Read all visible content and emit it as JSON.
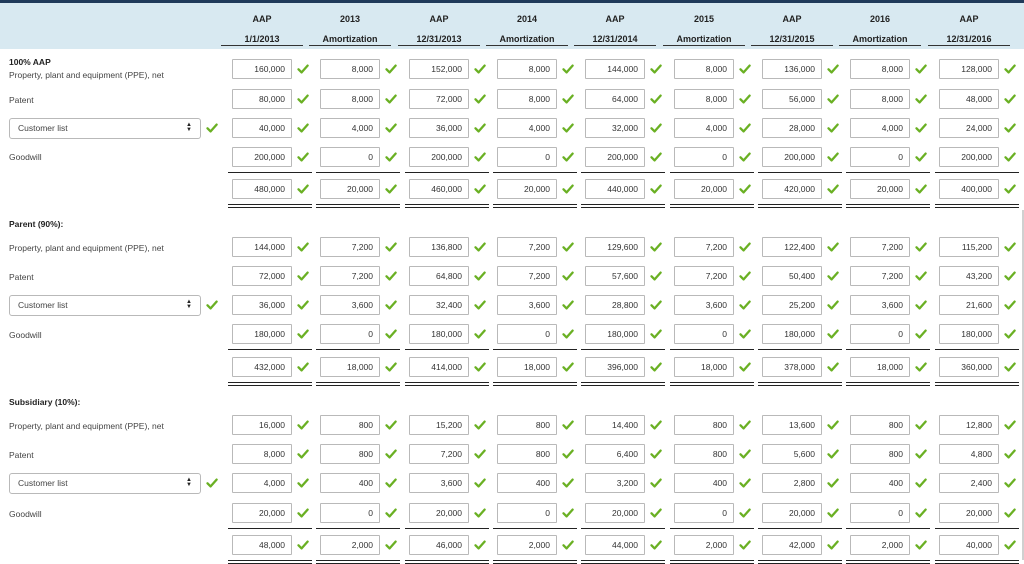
{
  "columns": [
    {
      "top": "AAP",
      "bottom": "1/1/2013"
    },
    {
      "top": "2013",
      "bottom": "Amortization"
    },
    {
      "top": "AAP",
      "bottom": "12/31/2013"
    },
    {
      "top": "2014",
      "bottom": "Amortization"
    },
    {
      "top": "AAP",
      "bottom": "12/31/2014"
    },
    {
      "top": "2015",
      "bottom": "Amortization"
    },
    {
      "top": "AAP",
      "bottom": "12/31/2015"
    },
    {
      "top": "2016",
      "bottom": "Amortization"
    },
    {
      "top": "AAP",
      "bottom": "12/31/2016"
    }
  ],
  "sections": [
    {
      "title": "100% AAP",
      "rows": [
        {
          "label": "Property, plant and equipment (PPE), net",
          "dropdown": false,
          "values": [
            "160,000",
            "8,000",
            "152,000",
            "8,000",
            "144,000",
            "8,000",
            "136,000",
            "8,000",
            "128,000"
          ]
        },
        {
          "label": "Patent",
          "dropdown": false,
          "values": [
            "80,000",
            "8,000",
            "72,000",
            "8,000",
            "64,000",
            "8,000",
            "56,000",
            "8,000",
            "48,000"
          ]
        },
        {
          "label": "Customer list",
          "dropdown": true,
          "values": [
            "40,000",
            "4,000",
            "36,000",
            "4,000",
            "32,000",
            "4,000",
            "28,000",
            "4,000",
            "24,000"
          ]
        },
        {
          "label": "Goodwill",
          "dropdown": false,
          "values": [
            "200,000",
            "0",
            "200,000",
            "0",
            "200,000",
            "0",
            "200,000",
            "0",
            "200,000"
          ]
        }
      ],
      "totals": [
        "480,000",
        "20,000",
        "460,000",
        "20,000",
        "440,000",
        "20,000",
        "420,000",
        "20,000",
        "400,000"
      ]
    },
    {
      "title": "Parent (90%):",
      "rows": [
        {
          "label": "Property, plant and equipment (PPE), net",
          "dropdown": false,
          "values": [
            "144,000",
            "7,200",
            "136,800",
            "7,200",
            "129,600",
            "7,200",
            "122,400",
            "7,200",
            "115,200"
          ]
        },
        {
          "label": "Patent",
          "dropdown": false,
          "values": [
            "72,000",
            "7,200",
            "64,800",
            "7,200",
            "57,600",
            "7,200",
            "50,400",
            "7,200",
            "43,200"
          ]
        },
        {
          "label": "Customer list",
          "dropdown": true,
          "values": [
            "36,000",
            "3,600",
            "32,400",
            "3,600",
            "28,800",
            "3,600",
            "25,200",
            "3,600",
            "21,600"
          ]
        },
        {
          "label": "Goodwill",
          "dropdown": false,
          "values": [
            "180,000",
            "0",
            "180,000",
            "0",
            "180,000",
            "0",
            "180,000",
            "0",
            "180,000"
          ]
        }
      ],
      "totals": [
        "432,000",
        "18,000",
        "414,000",
        "18,000",
        "396,000",
        "18,000",
        "378,000",
        "18,000",
        "360,000"
      ]
    },
    {
      "title": "Subsidiary (10%):",
      "rows": [
        {
          "label": "Property, plant and equipment (PPE), net",
          "dropdown": false,
          "values": [
            "16,000",
            "800",
            "15,200",
            "800",
            "14,400",
            "800",
            "13,600",
            "800",
            "12,800"
          ]
        },
        {
          "label": "Patent",
          "dropdown": false,
          "values": [
            "8,000",
            "800",
            "7,200",
            "800",
            "6,400",
            "800",
            "5,600",
            "800",
            "4,800"
          ]
        },
        {
          "label": "Customer list",
          "dropdown": true,
          "values": [
            "4,000",
            "400",
            "3,600",
            "400",
            "3,200",
            "400",
            "2,800",
            "400",
            "2,400"
          ]
        },
        {
          "label": "Goodwill",
          "dropdown": false,
          "values": [
            "20,000",
            "0",
            "20,000",
            "0",
            "20,000",
            "0",
            "20,000",
            "0",
            "20,000"
          ]
        }
      ],
      "totals": [
        "48,000",
        "2,000",
        "46,000",
        "2,000",
        "44,000",
        "2,000",
        "42,000",
        "2,000",
        "40,000"
      ]
    }
  ],
  "icons": {
    "correct": "check-icon",
    "dropdown": "select-arrows-icon"
  },
  "colors": {
    "header_bg": "#d8e9f1",
    "check": "#6ab023",
    "top_bar": "#1f3a5a"
  }
}
